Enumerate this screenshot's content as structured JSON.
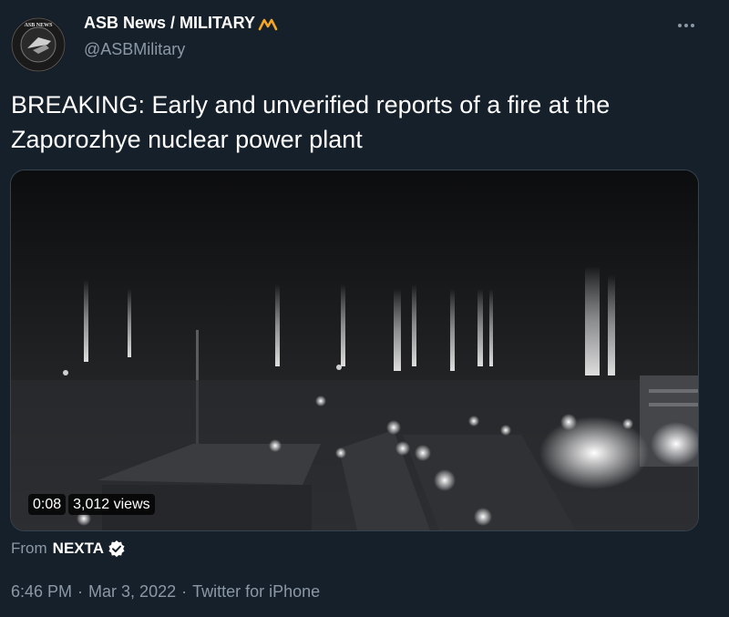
{
  "author": {
    "display_name": "ASB News / MILITARY",
    "handle": "@ASBMilitary",
    "avatar_text": "ASB NEWS"
  },
  "tweet": {
    "text": "BREAKING: Early and unverified reports of a fire at the Zaporozhye nuclear power plant"
  },
  "media": {
    "duration": "0:08",
    "views": "3,012 views"
  },
  "source": {
    "label": "From",
    "name": "NEXTA"
  },
  "meta": {
    "time": "6:46 PM",
    "date": "Mar 3, 2022",
    "client": "Twitter for iPhone",
    "separator": "·"
  },
  "colors": {
    "background": "#15202b",
    "secondary_text": "#8b98a5",
    "badge_gold": "#f5a623",
    "verified_bg": "#ffffff"
  }
}
